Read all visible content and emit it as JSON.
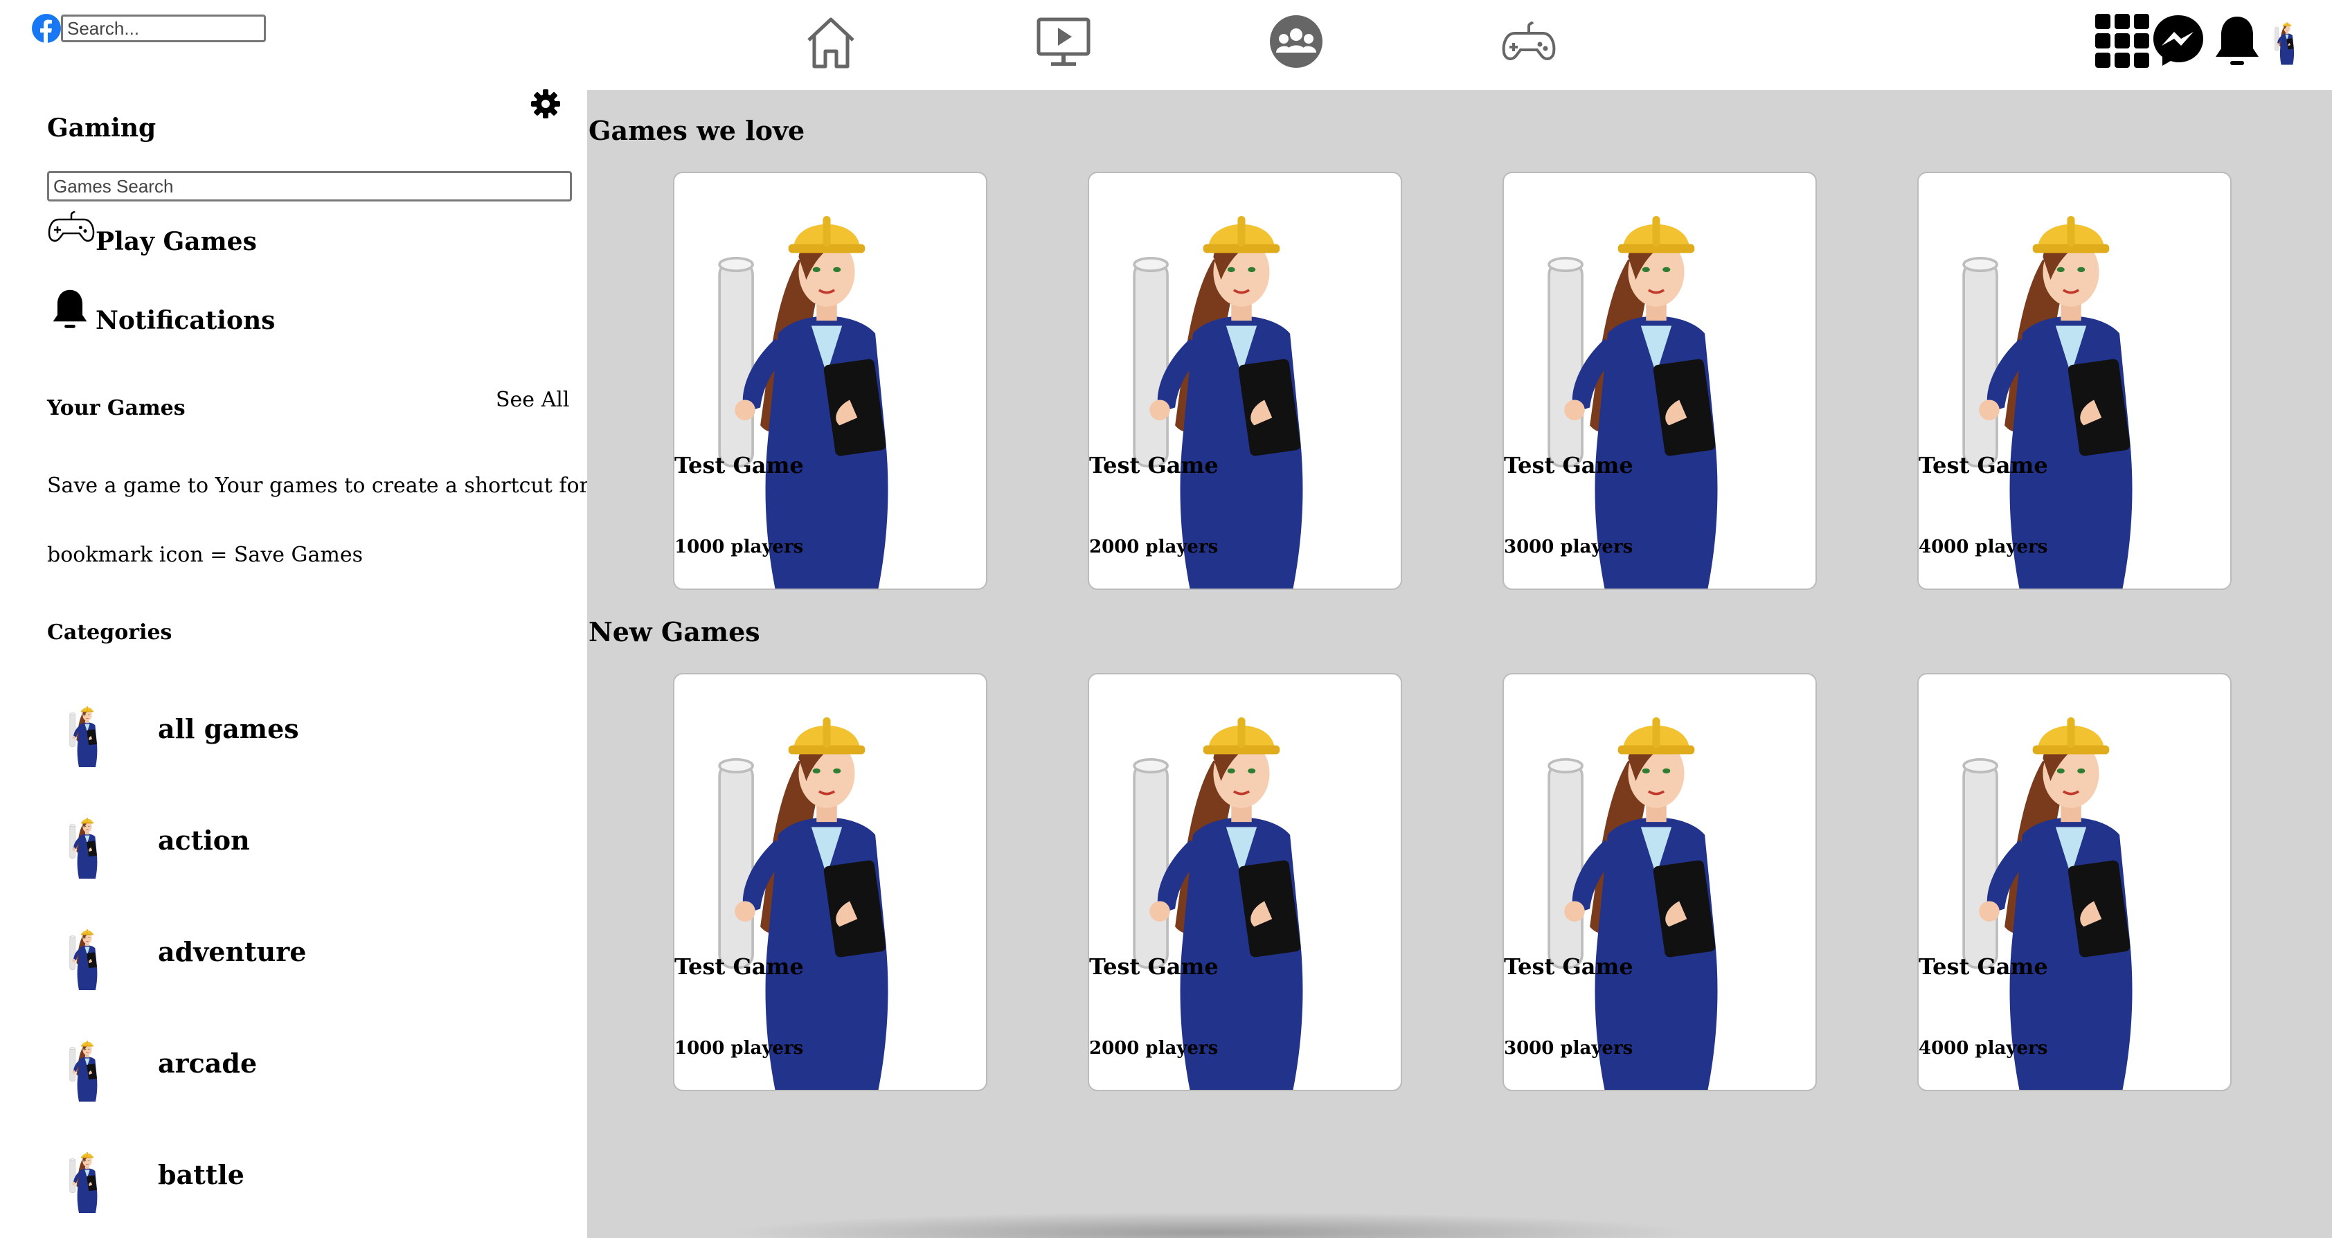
{
  "topbar": {
    "search_placeholder": "Search...",
    "nav_icons": [
      "home-icon",
      "watch-icon",
      "groups-icon",
      "gaming-icon"
    ],
    "right_icons": [
      "menu-grid-icon",
      "messenger-icon",
      "bell-icon",
      "profile-avatar"
    ]
  },
  "sidebar": {
    "title": "Gaming",
    "search_placeholder": "Games Search",
    "links": [
      {
        "label": "Play Games",
        "icon": "gamepad-icon"
      },
      {
        "label": "Notifications",
        "icon": "bell-icon"
      }
    ],
    "your_games": {
      "heading": "Your Games",
      "see_all": "See All",
      "hint": "Save a game to Your games to create a shortcut for it here",
      "bookmark_note": "bookmark icon = Save Games"
    },
    "categories_heading": "Categories",
    "categories": [
      "all games",
      "action",
      "adventure",
      "arcade",
      "battle"
    ]
  },
  "main": {
    "sections": [
      {
        "title": "Games we love",
        "cards": [
          {
            "name": "Test Game",
            "players": "1000 players"
          },
          {
            "name": "Test Game",
            "players": "2000 players"
          },
          {
            "name": "Test Game",
            "players": "3000 players"
          },
          {
            "name": "Test Game",
            "players": "4000 players"
          }
        ]
      },
      {
        "title": "New Games",
        "cards": [
          {
            "name": "Test Game",
            "players": "1000 players"
          },
          {
            "name": "Test Game",
            "players": "2000 players"
          },
          {
            "name": "Test Game",
            "players": "3000 players"
          },
          {
            "name": "Test Game",
            "players": "4000 players"
          }
        ]
      }
    ]
  },
  "colors": {
    "main_background": "#d3d3d3",
    "facebook_blue": "#1877f2",
    "icon_gray": "#666666",
    "suit_blue": "#22338c",
    "helmet_yellow": "#f2c230"
  }
}
